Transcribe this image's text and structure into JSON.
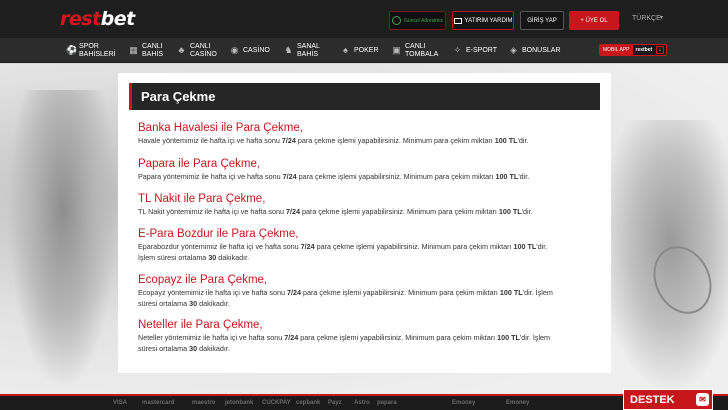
{
  "header": {
    "logo_part1": "rest",
    "logo_part2": "bet",
    "address_button": "Güncel Adresimiz",
    "help_button": "YATIRIM YARDIM",
    "login_button": "GİRİŞ YAP",
    "signup_button": "+ ÜYE OL",
    "language": "TÜRKÇE"
  },
  "nav": {
    "items": [
      {
        "label": "SPOR\nBAHİSLERİ",
        "icon": "sports-icon"
      },
      {
        "label": "CANLI\nBAHİS",
        "icon": "live-bet-icon"
      },
      {
        "label": "CANLI\nCASİNO",
        "icon": "live-casino-icon"
      },
      {
        "label": "CASİNO",
        "icon": "casino-icon"
      },
      {
        "label": "SANAL\nBAHİS",
        "icon": "virtual-bet-icon"
      },
      {
        "label": "POKER",
        "icon": "poker-icon"
      },
      {
        "label": "CANLI\nTOMBALA",
        "icon": "tombala-icon"
      },
      {
        "label": "E-SPORT",
        "icon": "esport-icon"
      },
      {
        "label": "BONUSLAR",
        "icon": "bonus-icon"
      }
    ],
    "mobile_app_label": "MOBIL APP",
    "mobile_app_brand": "restbet"
  },
  "panel": {
    "title": "Para Çekme",
    "methods": [
      {
        "title": "Banka Havalesi ile Para Çekme,",
        "text_before": "Havale yöntemimiz ile hafta içi ve hafta sonu ",
        "hours": "7/24",
        "text_mid": " para çekme işlemi yapabilirsiniz. Minimum para çekim miktarı ",
        "amount": "100 TL",
        "text_after": "'dir.",
        "extra_before": "",
        "extra_num": "",
        "extra_after": ""
      },
      {
        "title": "Papara ile Para Çekme,",
        "text_before": "Papara yöntemimiz ile hafta içi ve hafta sonu ",
        "hours": "7/24",
        "text_mid": " para çekme işlemi yapabilirsiniz. Minimum para çekim miktarı ",
        "amount": "100 TL",
        "text_after": "'dir.",
        "extra_before": "",
        "extra_num": "",
        "extra_after": ""
      },
      {
        "title": "TL Nakit ile Para Çekme,",
        "text_before": "TL Nakit yöntemimiz ile hafta içi ve hafta sonu ",
        "hours": "7/24",
        "text_mid": " para çekme işlemi yapabilirsiniz. Minimum para çekim miktarı ",
        "amount": "100 TL",
        "text_after": "'dir.",
        "extra_before": "",
        "extra_num": "",
        "extra_after": ""
      },
      {
        "title": "E-Para Bozdur ile Para Çekme,",
        "text_before": "Eparabozdur yöntemimiz ile hafta içi ve hafta sonu ",
        "hours": "7/24",
        "text_mid": " para çekme işlemi yapabilirsiniz. Minimum para çekim miktarı ",
        "amount": "100 TL",
        "text_after": "'dir.",
        "extra_before": "İşlem süresi ortalama ",
        "extra_num": "30",
        "extra_after": " dakikadır."
      },
      {
        "title": "Ecopayz ile Para Çekme,",
        "text_before": "Ecopayz yöntemimiz ile hafta içi ve hafta sonu ",
        "hours": "7/24",
        "text_mid": " para çekme işlemi yapabilirsiniz. Minimum para çekim miktarı ",
        "amount": "100 TL",
        "text_after": "'dir. İşlem",
        "extra_before": "süresi ortalama ",
        "extra_num": "30",
        "extra_after": " dakikadır."
      },
      {
        "title": "Neteller ile Para Çekme,",
        "text_before": "Neteller yöntemimiz ile hafta içi ve hafta sonu ",
        "hours": "7/24",
        "text_mid": " para çekme işlemi yapabilirsiniz. Minimum para çekim miktarı ",
        "amount": "100 TL",
        "text_after": "'dir. İşlem",
        "extra_before": "süresi ortalama ",
        "extra_num": "30",
        "extra_after": " dakikadır."
      }
    ]
  },
  "footer": {
    "payment_logos": [
      "VISA",
      "mastercard",
      "maestro",
      "jetonbank",
      "CUCKPAY",
      "cepbank",
      "Payz",
      "Astro",
      "papara",
      "Emoney",
      "Emoney"
    ]
  },
  "support_button": "DESTEK",
  "colors": {
    "accent": "#c8161d",
    "dark": "#1e1e1e"
  }
}
